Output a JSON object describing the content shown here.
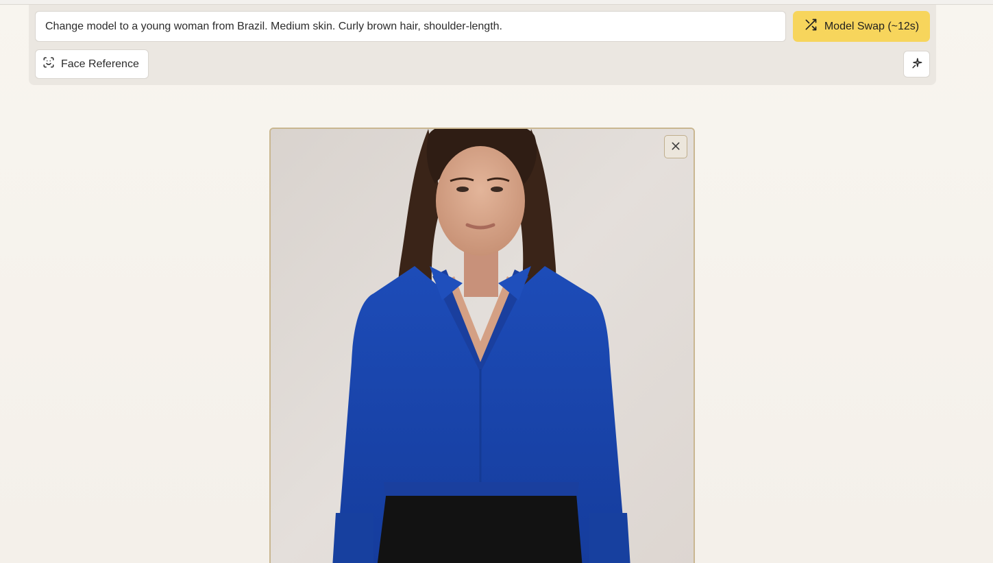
{
  "toolbar": {
    "prompt_value": "Change model to a young woman from Brazil. Medium skin. Curly brown hair, shoulder-length.",
    "swap_label": "Model Swap (~12s)",
    "face_reference_label": "Face Reference",
    "swap_icon": "shuffle-icon",
    "face_icon": "face-scan-icon",
    "magic_icon": "sparkle-icon"
  },
  "preview": {
    "close_icon": "close-icon"
  },
  "colors": {
    "accent": "#f7d55c",
    "frame_border": "#c9b690",
    "shirt": "#1a47b0"
  }
}
